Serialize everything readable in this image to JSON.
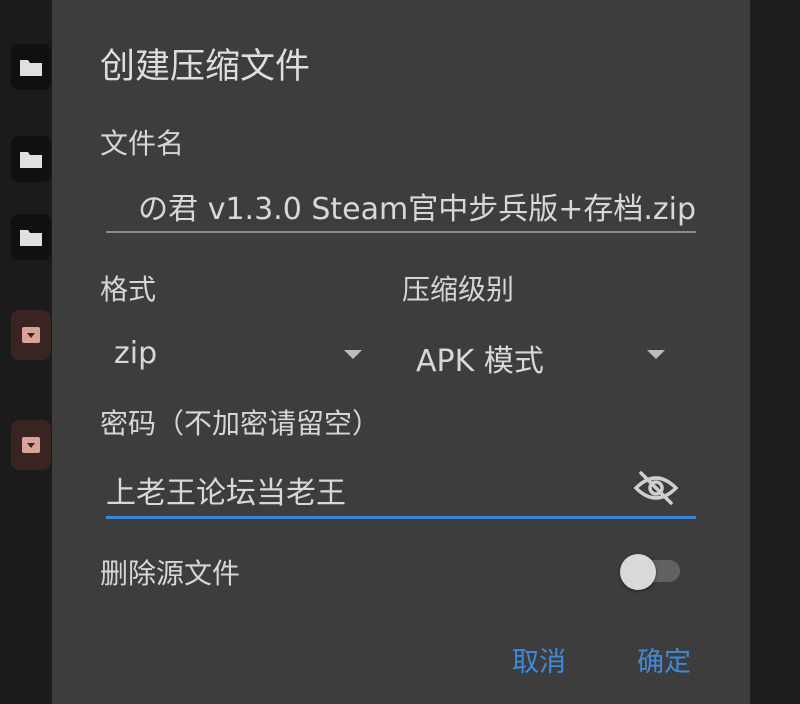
{
  "dialog": {
    "title": "创建压缩文件",
    "filename_label": "文件名",
    "filename_value": "の君 v1.3.0 Steam官中步兵版+存档.zip",
    "format_label": "格式",
    "format_value": "zip",
    "level_label": "压缩级别",
    "level_value": "APK 模式",
    "password_label": "密码（不加密请留空）",
    "password_value": "上老王论坛当老王",
    "delete_source_label": "删除源文件",
    "delete_source_enabled": false,
    "cancel_label": "取消",
    "confirm_label": "确定"
  },
  "colors": {
    "accent": "#3b86d6",
    "dialog_bg": "#3d3d3d",
    "text": "#d8d8d8"
  },
  "icons": [
    "folder-icon",
    "archive-icon",
    "visibility-off-icon",
    "dropdown-arrow-icon"
  ]
}
